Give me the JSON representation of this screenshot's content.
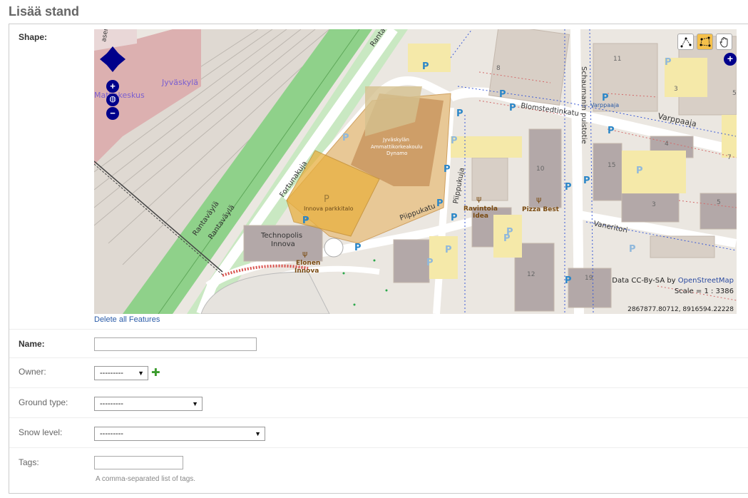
{
  "page": {
    "title": "Lisää stand"
  },
  "form": {
    "shape": {
      "label": "Shape:",
      "delete_link": "Delete all Features",
      "map": {
        "attribution_prefix": "Data CC-By-SA by",
        "attribution_link": "OpenStreetMap",
        "scale": "Scale = 1 : 3386",
        "coords": "2867877.80712, 8916594.22228",
        "labels": {
          "jyvaskyla": "Jyväskylä",
          "matkakeskus": "Matkakeskus",
          "rantavayla1": "Rantaväylä",
          "rantavayla2": "Rantaväylä",
          "rantavayla_top": "Rantaväylä",
          "fortunakuja": "Fortunakuja",
          "piippukatu": "Piippukatu",
          "piippukuja": "Piippukuja",
          "blomstedtinkatu": "Blomstedtinkatu",
          "varppaaja": "Varppaaja",
          "varppaaja_small": "Varppaaja",
          "schaumanin": "Schaumanin puistotie",
          "vaneritori": "Vaneritori",
          "jamk_1": "Jyväskylän",
          "jamk_2": "Ammattikorkeakoulu",
          "jamk_3": "Dynamo",
          "innova_parkkitalo": "Innova parkkitalo",
          "technopolis_1": "Technopolis",
          "technopolis_2": "Innova",
          "elonen_1": "Elonen",
          "elonen_2": "Innova",
          "ravintola_1": "Ravintola",
          "ravintola_2": "Idea",
          "pizza_best": "Pizza Best",
          "ase_top": "asenka",
          "n8": "8",
          "n11": "11",
          "n3a": "3",
          "n5a": "5",
          "n4": "4",
          "n10": "10",
          "n15": "15",
          "n3b": "3",
          "n5b": "5",
          "n12": "12",
          "n19": "19",
          "n7": "7",
          "parking": "P"
        }
      }
    },
    "name": {
      "label": "Name:",
      "value": ""
    },
    "owner": {
      "label": "Owner:",
      "selected": "---------"
    },
    "ground_type": {
      "label": "Ground type:",
      "selected": "---------"
    },
    "snow_level": {
      "label": "Snow level:",
      "selected": "---------"
    },
    "tags": {
      "label": "Tags:",
      "value": "",
      "help": "A comma-separated list of tags."
    }
  },
  "icons": {
    "pan": "pan-arrows-icon",
    "zoom_in": "zoom-in-icon",
    "zoom_world": "zoom-world-icon",
    "zoom_out": "zoom-out-icon",
    "draw_line": "draw-line-icon",
    "draw_polygon": "draw-polygon-icon",
    "navigate": "hand-icon",
    "layers": "layer-switcher-icon",
    "add": "add-icon"
  },
  "colors": {
    "title": "#666666",
    "link": "#2a5ba8",
    "map_control": "#00008b",
    "highway": "#8fd18a",
    "stand_polygon": "#e3a73a",
    "add_icon": "#3a9b2c"
  }
}
